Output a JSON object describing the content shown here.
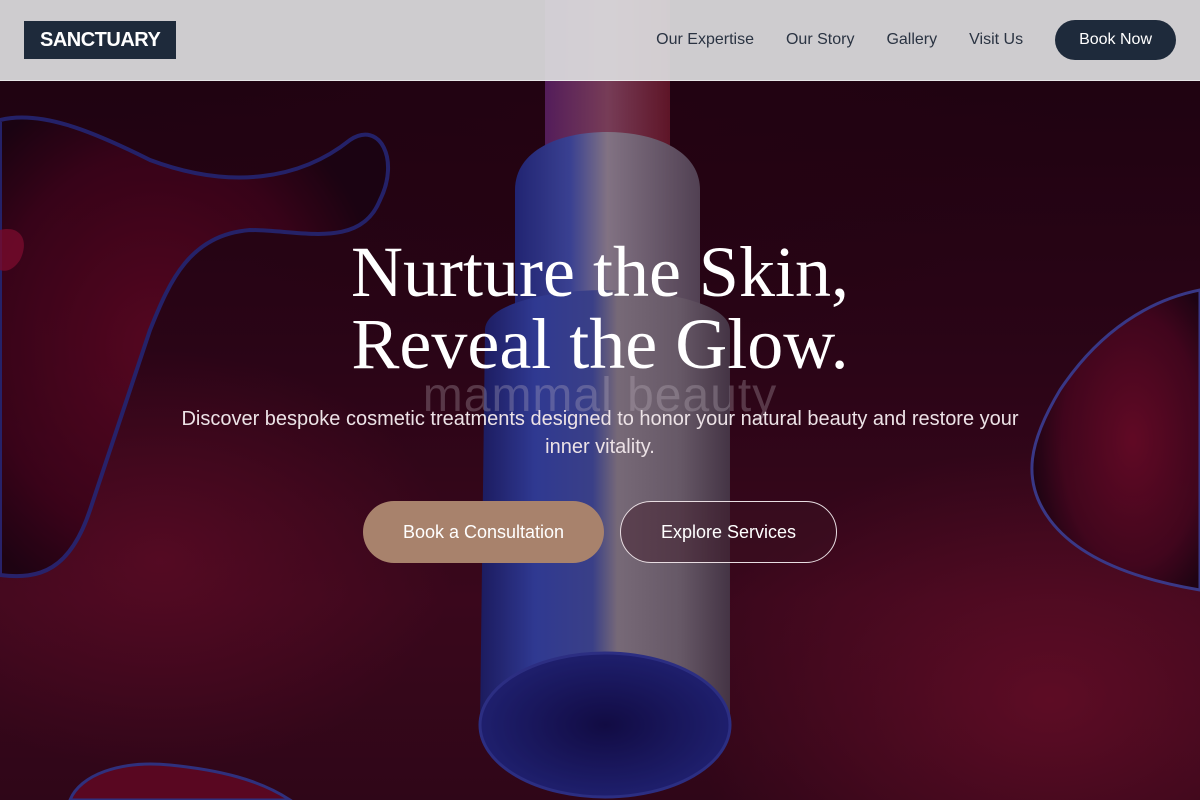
{
  "brand": {
    "logo_text": "SANCTUARY"
  },
  "nav": {
    "links": [
      {
        "label": "Our Expertise"
      },
      {
        "label": "Our Story"
      },
      {
        "label": "Gallery"
      },
      {
        "label": "Visit Us"
      }
    ],
    "cta_label": "Book Now"
  },
  "hero": {
    "headline_line1": "Nurture the Skin,",
    "headline_line2": "Reveal the Glow.",
    "watermark_text": "mammal beauty",
    "subtext": "Discover bespoke cosmetic treatments designed to honor your natural beauty and restore your inner vitality.",
    "primary_cta": "Book a Consultation",
    "secondary_cta": "Explore Services",
    "image_subject": "cosmetic-bottle-on-red-gel-background"
  },
  "colors": {
    "brand_navy": "#1e2a3b",
    "accent_tan": "#a8826c",
    "nav_bg": "#dcdcde",
    "hero_red": "#4a0c24"
  }
}
